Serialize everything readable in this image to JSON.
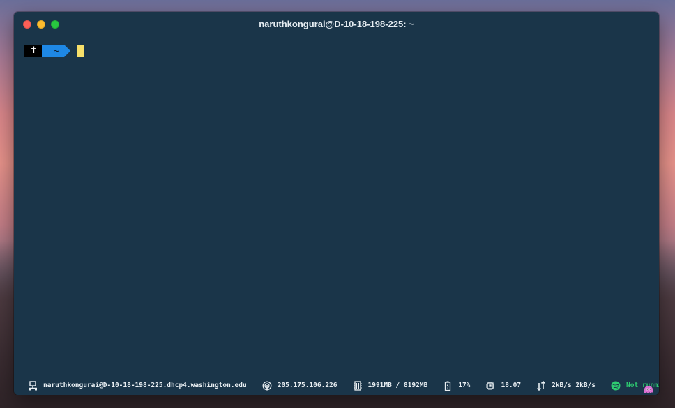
{
  "window": {
    "title": "naruthkongurai@D-10-18-198-225: ~"
  },
  "prompt": {
    "user_symbol": "✝",
    "directory": "~"
  },
  "statusbar": {
    "host": "naruthkongurai@D-10-18-198-225.dhcp4.washington.edu",
    "ip": "205.175.106.226",
    "memory": "1991MB / 8192MB",
    "battery": "17%",
    "cpu": "18.07",
    "network": "2kB/s 2kB/s",
    "spotify": "Not running"
  },
  "colors": {
    "terminal_bg": "#1a3549",
    "cursor": "#f7e06a",
    "dir_segment": "#1e88e5",
    "spotify_green": "#2ecc71"
  }
}
